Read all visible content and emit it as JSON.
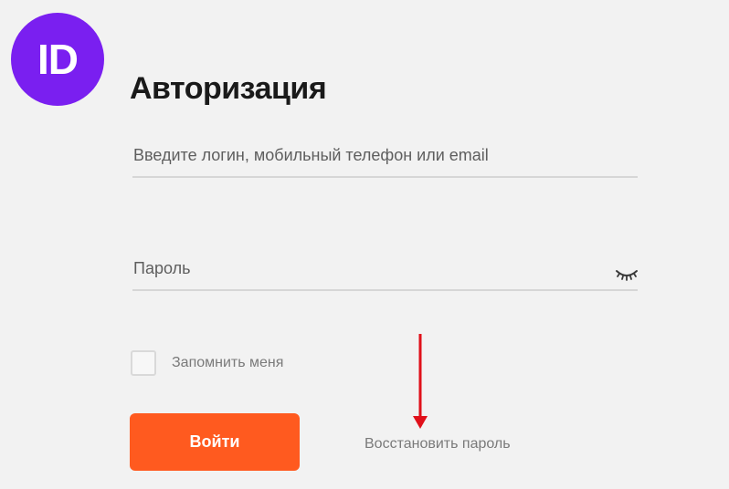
{
  "brand": {
    "logo_text": "ID",
    "color": "#7a1ff0"
  },
  "form": {
    "title": "Авторизация",
    "login_placeholder": "Введите логин, мобильный телефон или email",
    "password_placeholder": "Пароль",
    "password_toggle_icon": "eye-closed-icon",
    "remember_label": "Запомнить меня",
    "remember_checked": false,
    "submit_label": "Войти",
    "submit_color": "#ff5a1f",
    "restore_link": "Восстановить пароль"
  },
  "annotation": {
    "arrow_icon": "down-arrow-icon",
    "color": "#e0101a"
  }
}
